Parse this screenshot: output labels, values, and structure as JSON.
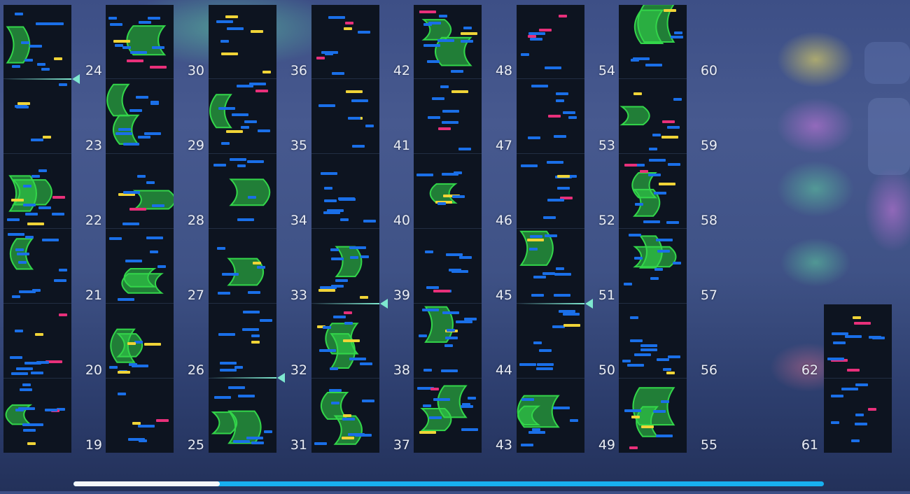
{
  "timeline": {
    "columns": [
      {
        "id": "c1",
        "labels": [
          "19",
          "20",
          "21",
          "22",
          "23",
          "24"
        ]
      },
      {
        "id": "c2",
        "labels": [
          "25",
          "26",
          "27",
          "28",
          "29",
          "30"
        ]
      },
      {
        "id": "c3",
        "labels": [
          "31",
          "32",
          "33",
          "34",
          "35",
          "36"
        ]
      },
      {
        "id": "c4",
        "labels": [
          "37",
          "38",
          "39",
          "40",
          "41",
          "42"
        ]
      },
      {
        "id": "c5",
        "labels": [
          "43",
          "44",
          "45",
          "46",
          "47",
          "48"
        ]
      },
      {
        "id": "c6",
        "labels": [
          "49",
          "50",
          "51",
          "52",
          "53",
          "54"
        ]
      },
      {
        "id": "c7",
        "labels": [
          "55",
          "56",
          "57",
          "58",
          "59",
          "60"
        ]
      },
      {
        "id": "c8",
        "labels": [
          "61",
          "62"
        ]
      }
    ]
  },
  "colors": {
    "tap_note": "#1a6fe8",
    "critical_note": "#f0d437",
    "flick_note": "#e8307a",
    "hold_note": "#33d64a",
    "panel_bg": "#0d1420",
    "progress_filled": "#f4f7fb",
    "progress_remaining": "#18b0f0"
  },
  "progress": {
    "fraction": 0.195
  }
}
